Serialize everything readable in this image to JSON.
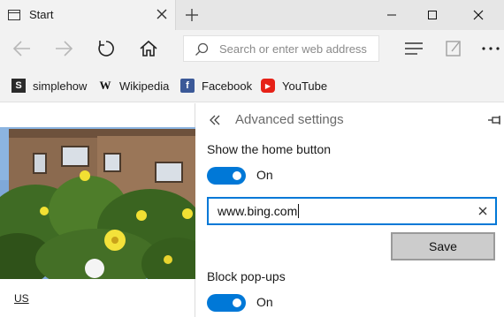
{
  "tab": {
    "title": "Start"
  },
  "address": {
    "placeholder": "Search or enter web address"
  },
  "favorites": [
    {
      "label": "simplehow",
      "icon": "simplehow-icon",
      "color": "#2b2b2b",
      "glyph": "S"
    },
    {
      "label": "Wikipedia",
      "icon": "wikipedia-icon",
      "color": "#ffffff",
      "glyph": "W"
    },
    {
      "label": "Facebook",
      "icon": "facebook-icon",
      "color": "#3b5998",
      "glyph": "f"
    },
    {
      "label": "YouTube",
      "icon": "youtube-icon",
      "color": "#e62117",
      "glyph": "▶"
    }
  ],
  "page": {
    "region_link": "US"
  },
  "settings": {
    "title": "Advanced settings",
    "home_button_label": "Show the home button",
    "home_toggle_state": "On",
    "home_url": "www.bing.com",
    "save_label": "Save",
    "popups_label": "Block pop-ups",
    "popups_toggle_state": "On"
  },
  "colors": {
    "accent": "#0078d7"
  }
}
